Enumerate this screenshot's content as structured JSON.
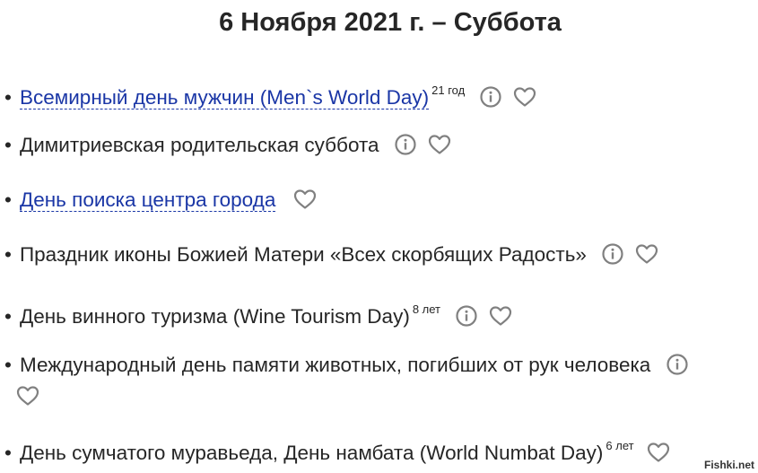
{
  "header": {
    "title": "6 Ноября 2021 г. – Суббота"
  },
  "bullet": "•",
  "holidays": [
    {
      "name": "Всемирный день мужчин (Men`s World Day)",
      "age": "21 год"
    },
    {
      "name": "Димитриевская родительская суббота"
    },
    {
      "name": "День поиска центра города"
    },
    {
      "name": "Праздник иконы Божией Матери «Всех скорбящих Радость»"
    },
    {
      "name": "День винного туризма (Wine Tourism Day)",
      "age": "8 лет"
    },
    {
      "name": "Международный день памяти животных, погибших от рук человека"
    },
    {
      "name": "День сумчатого муравьеда, День намбата (World Numbat Day)",
      "age": "6 лет"
    }
  ],
  "icons": {
    "info": "info-circle-icon",
    "favorite": "heart-outline-icon"
  },
  "colors": {
    "link": "#1a36a6",
    "text": "#262626",
    "icon": "#808080"
  },
  "watermark": "Fishki.net"
}
